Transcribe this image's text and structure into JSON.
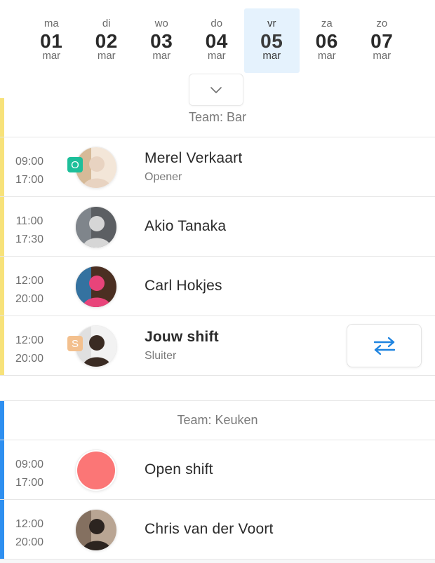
{
  "week": {
    "days": [
      {
        "name": "ma",
        "num": "01",
        "month": "mar",
        "selected": false
      },
      {
        "name": "di",
        "num": "02",
        "month": "mar",
        "selected": false
      },
      {
        "name": "wo",
        "num": "03",
        "month": "mar",
        "selected": false
      },
      {
        "name": "do",
        "num": "04",
        "month": "mar",
        "selected": false
      },
      {
        "name": "vr",
        "num": "05",
        "month": "mar",
        "selected": true
      },
      {
        "name": "za",
        "num": "06",
        "month": "mar",
        "selected": false
      },
      {
        "name": "zo",
        "num": "07",
        "month": "mar",
        "selected": false
      }
    ],
    "expand_icon": "chevron-down-icon"
  },
  "teams": [
    {
      "title": "Team: Bar",
      "color": "#f7e27a",
      "shifts": [
        {
          "start": "09:00",
          "end": "17:00",
          "name": "Merel Verkaart",
          "role": "Opener",
          "badge": "O",
          "badge_color": "#1dbf9a",
          "avatar": "person-photo",
          "avatar_colors": [
            "#c9a77d",
            "#e8d3c1",
            "#f3e6d8"
          ]
        },
        {
          "start": "11:00",
          "end": "17:30",
          "name": "Akio Tanaka",
          "role": "",
          "avatar": "person-photo",
          "avatar_colors": [
            "#8e959c",
            "#d6d6d6",
            "#5c5f63"
          ]
        },
        {
          "start": "12:00",
          "end": "20:00",
          "name": "Carl Hokjes",
          "role": "",
          "avatar": "person-photo",
          "avatar_colors": [
            "#2b8fd6",
            "#e8447a",
            "#4b2f22"
          ]
        },
        {
          "start": "12:00",
          "end": "20:00",
          "name": "Jouw shift",
          "role": "Sluiter",
          "badge": "S",
          "badge_color": "#f3c08e",
          "own": true,
          "avatar": "person-photo",
          "avatar_colors": [
            "#d8d8d8",
            "#3a2b23",
            "#f2f2f2"
          ],
          "action_icon": "swap-arrows-icon"
        }
      ]
    },
    {
      "title": "Team: Keuken",
      "color": "#2e8ff0",
      "shifts": [
        {
          "start": "09:00",
          "end": "17:00",
          "name": "Open shift",
          "role": "",
          "avatar": "open-shift-dot",
          "avatar_colors": [
            "#fb7676"
          ]
        },
        {
          "start": "12:00",
          "end": "20:00",
          "name": "Chris van der Voort",
          "role": "",
          "avatar": "person-photo",
          "avatar_colors": [
            "#6d5a4a",
            "#2c2420",
            "#b9a593"
          ]
        }
      ]
    }
  ]
}
